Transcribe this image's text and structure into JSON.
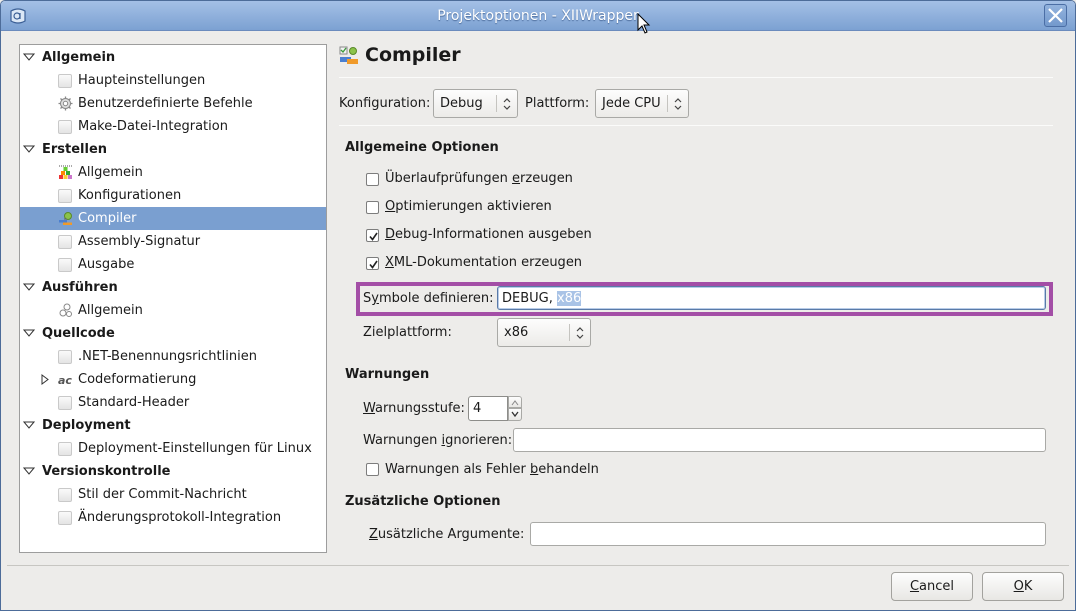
{
  "window": {
    "title": "Projektoptionen - XIIWrapper",
    "close_label": "Close"
  },
  "sidebar": {
    "categories": [
      {
        "label": "Allgemein",
        "expanded": true,
        "items": [
          {
            "label": "Haupteinstellungen",
            "icon": "blank-page-icon"
          },
          {
            "label": "Benutzerdefinierte Befehle",
            "icon": "gear-icon"
          },
          {
            "label": "Make-Datei-Integration",
            "icon": "blank-page-icon"
          }
        ]
      },
      {
        "label": "Erstellen",
        "expanded": true,
        "items": [
          {
            "label": "Allgemein",
            "icon": "build-blocks-icon"
          },
          {
            "label": "Konfigurationen",
            "icon": "blank-page-icon"
          },
          {
            "label": "Compiler",
            "icon": "compiler-icon",
            "selected": true
          },
          {
            "label": "Assembly-Signatur",
            "icon": "blank-page-icon"
          },
          {
            "label": "Ausgabe",
            "icon": "blank-page-icon"
          }
        ]
      },
      {
        "label": "Ausführen",
        "expanded": true,
        "items": [
          {
            "label": "Allgemein",
            "icon": "gears-icon"
          }
        ]
      },
      {
        "label": "Quellcode",
        "expanded": true,
        "items": [
          {
            "label": ".NET-Benennungsrichtlinien",
            "icon": "blank-page-icon"
          },
          {
            "label": "Codeformatierung",
            "icon": "code-format-icon",
            "expandable": true
          },
          {
            "label": "Standard-Header",
            "icon": "blank-page-icon"
          }
        ]
      },
      {
        "label": "Deployment",
        "expanded": true,
        "items": [
          {
            "label": "Deployment-Einstellungen für Linux",
            "icon": "blank-page-icon"
          }
        ]
      },
      {
        "label": "Versionskontrolle",
        "expanded": true,
        "items": [
          {
            "label": "Stil der Commit-Nachricht",
            "icon": "blank-page-icon"
          },
          {
            "label": "Änderungsprotokoll-Integration",
            "icon": "blank-page-icon"
          }
        ]
      }
    ]
  },
  "content": {
    "title": "Compiler",
    "configuration_label": "Konfiguration:",
    "configuration_value": "Debug",
    "platform_label": "Plattform:",
    "platform_value": "Jede CPU",
    "general_options": {
      "heading": "Allgemeine Optionen",
      "checkboxes": [
        {
          "label_pre": "Überlaufprüfungen ",
          "mnemonic": "e",
          "label_post": "rzeugen",
          "checked": false
        },
        {
          "label_pre": "",
          "mnemonic": "O",
          "label_post": "ptimierungen aktivieren",
          "checked": false
        },
        {
          "label_pre": "",
          "mnemonic": "D",
          "label_post": "ebug-Informationen ausgeben",
          "checked": true
        },
        {
          "label_pre": "",
          "mnemonic": "X",
          "label_post": "ML-Dokumentation erzeugen",
          "checked": true
        }
      ],
      "symbols_label_pre": "S",
      "symbols_label_mnemonic": "y",
      "symbols_label_post": "mbole definieren:",
      "symbols_value_plain": "DEBUG, ",
      "symbols_value_selected": "x86",
      "target_label": "Zielplattform:",
      "target_value": "x86"
    },
    "warnings": {
      "heading": "Warnungen",
      "level_label_mnemonic": "W",
      "level_label_post": "arnungsstufe:",
      "level_value": "4",
      "ignore_label_pre": "Warnungen ",
      "ignore_label_mnemonic": "i",
      "ignore_label_post": "gnorieren:",
      "ignore_value": "",
      "as_errors_pre": "Warnungen als Fehler ",
      "as_errors_mnemonic": "b",
      "as_errors_post": "ehandeln",
      "as_errors_checked": false
    },
    "additional": {
      "heading": "Zusätzliche Optionen",
      "args_label_mnemonic": "Z",
      "args_label_post": "usätzliche Argumente:",
      "args_value": ""
    }
  },
  "buttons": {
    "cancel_mnemonic": "C",
    "cancel_post": "ancel",
    "ok_mnemonic": "O",
    "ok_post": "K"
  },
  "colors": {
    "selection": "#7a9fd0",
    "highlight_box": "#a34ea6",
    "titlebar": "#8eaedb"
  }
}
